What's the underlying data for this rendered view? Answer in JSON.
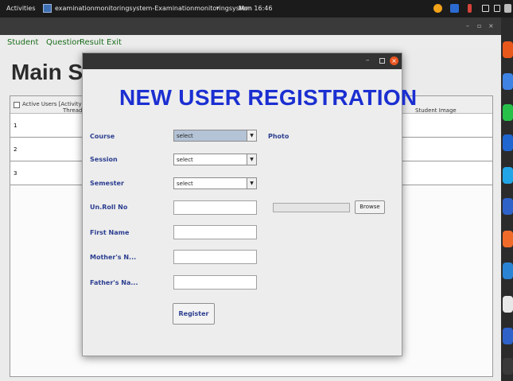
{
  "topbar": {
    "activities": "Activities",
    "app_title": "examinationmonitoringsystem-Examinationmonitoringsystem",
    "app_caret": "▾",
    "clock": "Mon 16:46"
  },
  "mainwin": {
    "controls": {
      "minimize": "–",
      "maximize": "▫",
      "close": "×"
    },
    "menu": {
      "student": "Student",
      "question": "Question",
      "result": "Result",
      "exit": "Exit"
    },
    "page_heading": "Main Se",
    "table": {
      "checkbox_label": "Active Users [Activity Trac",
      "col_thread": "Thread I",
      "col_student_image": "Student Image",
      "rows": [
        "1",
        "2",
        "3"
      ]
    }
  },
  "dialog": {
    "controls": {
      "minimize": "–",
      "close": "×"
    },
    "title": "NEW USER REGISTRATION",
    "fields": {
      "course": {
        "label": "Course",
        "value": "select"
      },
      "session": {
        "label": "Session",
        "value": "select"
      },
      "semester": {
        "label": "Semester",
        "value": "select"
      },
      "roll_no": {
        "label": "Un.Roll No"
      },
      "first_name": {
        "label": "First Name"
      },
      "mother_name": {
        "label": "Mother's N..."
      },
      "father_name": {
        "label": "Father's Na..."
      }
    },
    "photo_label": "Photo",
    "browse_label": "Browse",
    "register_label": "Register"
  },
  "colors": {
    "title_blue": "#1b2fd1",
    "label_navy": "#2c3e90",
    "menu_green": "#1b6d1b",
    "ubuntu_orange": "#e95420"
  },
  "dock_icons": [
    "firefox-icon",
    "chrome-icon",
    "whatsapp-icon",
    "close-x-icon",
    "skype-icon",
    "box-icon",
    "appcenter-icon",
    "help-icon",
    "editor-icon",
    "box-icon",
    "apps-grid-icon"
  ]
}
